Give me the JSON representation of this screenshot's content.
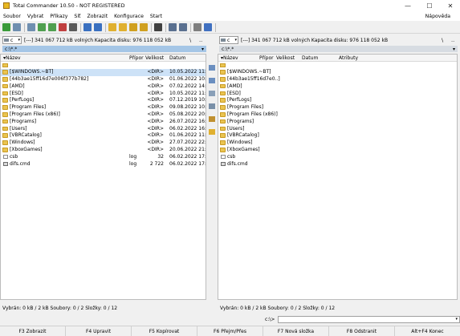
{
  "window": {
    "title": "Total Commander 10.50 - NOT REGISTERED",
    "controls": [
      "—",
      "☐",
      "✕"
    ]
  },
  "menu": {
    "items": [
      "Soubor",
      "Vybrat",
      "Příkazy",
      "Síť",
      "Zobrazit",
      "Konfigurace",
      "Start"
    ],
    "help": "Nápověda"
  },
  "toolbar": {
    "buttons": [
      {
        "name": "refresh-icon",
        "color": "#3a9b3a"
      },
      {
        "name": "view-brief-icon",
        "color": "#6f8fb0"
      },
      {
        "name": "view-full-icon",
        "color": "#6f8fb0"
      },
      {
        "name": "view-tree-icon",
        "color": "#4f9f4f"
      },
      {
        "name": "view-thumbs-icon",
        "color": "#4f9f4f"
      },
      {
        "name": "sort-icon",
        "color": "#c04040"
      },
      {
        "name": "invert-selection-icon",
        "color": "#5a5a5a"
      },
      {
        "name": "back-icon",
        "color": "#3a70c0"
      },
      {
        "name": "forward-icon",
        "color": "#3a70c0"
      },
      {
        "name": "pack-icon",
        "color": "#e0b030"
      },
      {
        "name": "unpack-icon",
        "color": "#e0b030"
      },
      {
        "name": "ftp-icon",
        "color": "#d0a020"
      },
      {
        "name": "ftp-disconnect-icon",
        "color": "#d0a020"
      },
      {
        "name": "search-icon",
        "color": "#404040"
      },
      {
        "name": "multi-rename-icon",
        "color": "#5a7090"
      },
      {
        "name": "sync-dirs-icon",
        "color": "#5a7090"
      },
      {
        "name": "copy-names-icon",
        "color": "#7f7f7f"
      },
      {
        "name": "notepad-icon",
        "color": "#4070c0"
      }
    ]
  },
  "left_panel": {
    "drive": "c",
    "drive_info": "[---]  341 067 712 kB volných  Kapacita disku: 976 118 052 kB",
    "path": "c:\\*.*",
    "nav_back": "\\",
    "nav_up": "..",
    "headers": {
      "name": "▾Název",
      "ext": "Přípor",
      "size": "Velikost",
      "date": "Datum"
    },
    "rows": [
      {
        "icon": "up",
        "name": "",
        "ext": "",
        "size": "",
        "date": "",
        "selected": false
      },
      {
        "icon": "folder",
        "name": "[$WINDOWS.~BT]",
        "ext": "",
        "size": "<DIR>",
        "date": "10.05.2022 11:49",
        "selected": true
      },
      {
        "icon": "folder",
        "name": "[44b3ae15ff16d7e006f377b782]",
        "ext": "",
        "size": "<DIR>",
        "date": "01.06.2022 10:58",
        "selected": false
      },
      {
        "icon": "folder",
        "name": "[AMD]",
        "ext": "",
        "size": "<DIR>",
        "date": "07.02.2022 14:37",
        "selected": false
      },
      {
        "icon": "folder",
        "name": "[ESD]",
        "ext": "",
        "size": "<DIR>",
        "date": "10.05.2022 11:53",
        "selected": false
      },
      {
        "icon": "folder",
        "name": "[PerfLogs]",
        "ext": "",
        "size": "<DIR>",
        "date": "07.12.2019 10:14",
        "selected": false
      },
      {
        "icon": "folder",
        "name": "[Program Files]",
        "ext": "",
        "size": "<DIR>",
        "date": "09.08.2022 10:32",
        "selected": false
      },
      {
        "icon": "folder",
        "name": "[Program Files (x86)]",
        "ext": "",
        "size": "<DIR>",
        "date": "05.08.2022 20:24",
        "selected": false
      },
      {
        "icon": "folder",
        "name": "[Programs]",
        "ext": "",
        "size": "<DIR>",
        "date": "26.07.2022 16:48",
        "selected": false
      },
      {
        "icon": "folder",
        "name": "[Users]",
        "ext": "",
        "size": "<DIR>",
        "date": "06.02.2022 16:24",
        "selected": false
      },
      {
        "icon": "folder",
        "name": "[VBRCatalog]",
        "ext": "",
        "size": "<DIR>",
        "date": "01.06.2022 11:06",
        "selected": false
      },
      {
        "icon": "folder",
        "name": "[Windows]",
        "ext": "",
        "size": "<DIR>",
        "date": "27.07.2022 22:24",
        "selected": false
      },
      {
        "icon": "folder",
        "name": "[XboxGames]",
        "ext": "",
        "size": "<DIR>",
        "date": "20.06.2022 21:11",
        "selected": false
      },
      {
        "icon": "file",
        "name": "csb",
        "ext": "log",
        "size": "32",
        "date": "06.02.2022 17:15",
        "selected": false
      },
      {
        "icon": "cmd",
        "name": "difs.cmd",
        "ext": "log",
        "size": "2 722",
        "date": "06.02.2022 17:15",
        "selected": false
      }
    ],
    "status": "Vybrán: 0 kB / 2 kB  Soubory: 0 / 2  Složky: 0 / 12"
  },
  "right_panel": {
    "drive": "c",
    "drive_info": "[---]  341 067 712 kB volných  Kapacita disku: 976 118 052 kB",
    "path": "c:\\*.*",
    "nav_back": "\\",
    "nav_up": "..",
    "headers": {
      "name": "▾Název",
      "ext": "Přípor",
      "size": "Velikost",
      "date": "Datum",
      "attr": "Atributy"
    },
    "rows": [
      {
        "icon": "up",
        "name": ""
      },
      {
        "icon": "folder",
        "name": "[$WINDOWS.~BT]"
      },
      {
        "icon": "folder",
        "name": "[44b3ae15ff16d7e0..]"
      },
      {
        "icon": "folder",
        "name": "[AMD]"
      },
      {
        "icon": "folder",
        "name": "[ESD]"
      },
      {
        "icon": "folder",
        "name": "[PerfLogs]"
      },
      {
        "icon": "folder",
        "name": "[Program Files]"
      },
      {
        "icon": "folder",
        "name": "[Program Files (x86)]"
      },
      {
        "icon": "folder",
        "name": "[Programs]"
      },
      {
        "icon": "folder",
        "name": "[Users]"
      },
      {
        "icon": "folder",
        "name": "[VBRCatalog]"
      },
      {
        "icon": "folder",
        "name": "[Windows]"
      },
      {
        "icon": "folder",
        "name": "[XboxGames]"
      },
      {
        "icon": "file",
        "name": "csb"
      },
      {
        "icon": "cmd",
        "name": "difs.cmd"
      }
    ],
    "status": "Vybrán: 0 kB / 2 kB  Soubory: 0 / 2  Složky: 0 / 12"
  },
  "middle_tools": [
    "copy-icon",
    "move-icon",
    "compare-icon",
    "pack-icon",
    "delete-icon",
    "newfolder-icon"
  ],
  "command_line": {
    "label": "c:\\>",
    "value": ""
  },
  "function_keys": [
    "F3 Zobrazit",
    "F4 Upravit",
    "F5 Kopírovat",
    "F6 Přejm/Přes",
    "F7 Nová složka",
    "F8 Odstranit",
    "Alt+F4 Konec"
  ]
}
